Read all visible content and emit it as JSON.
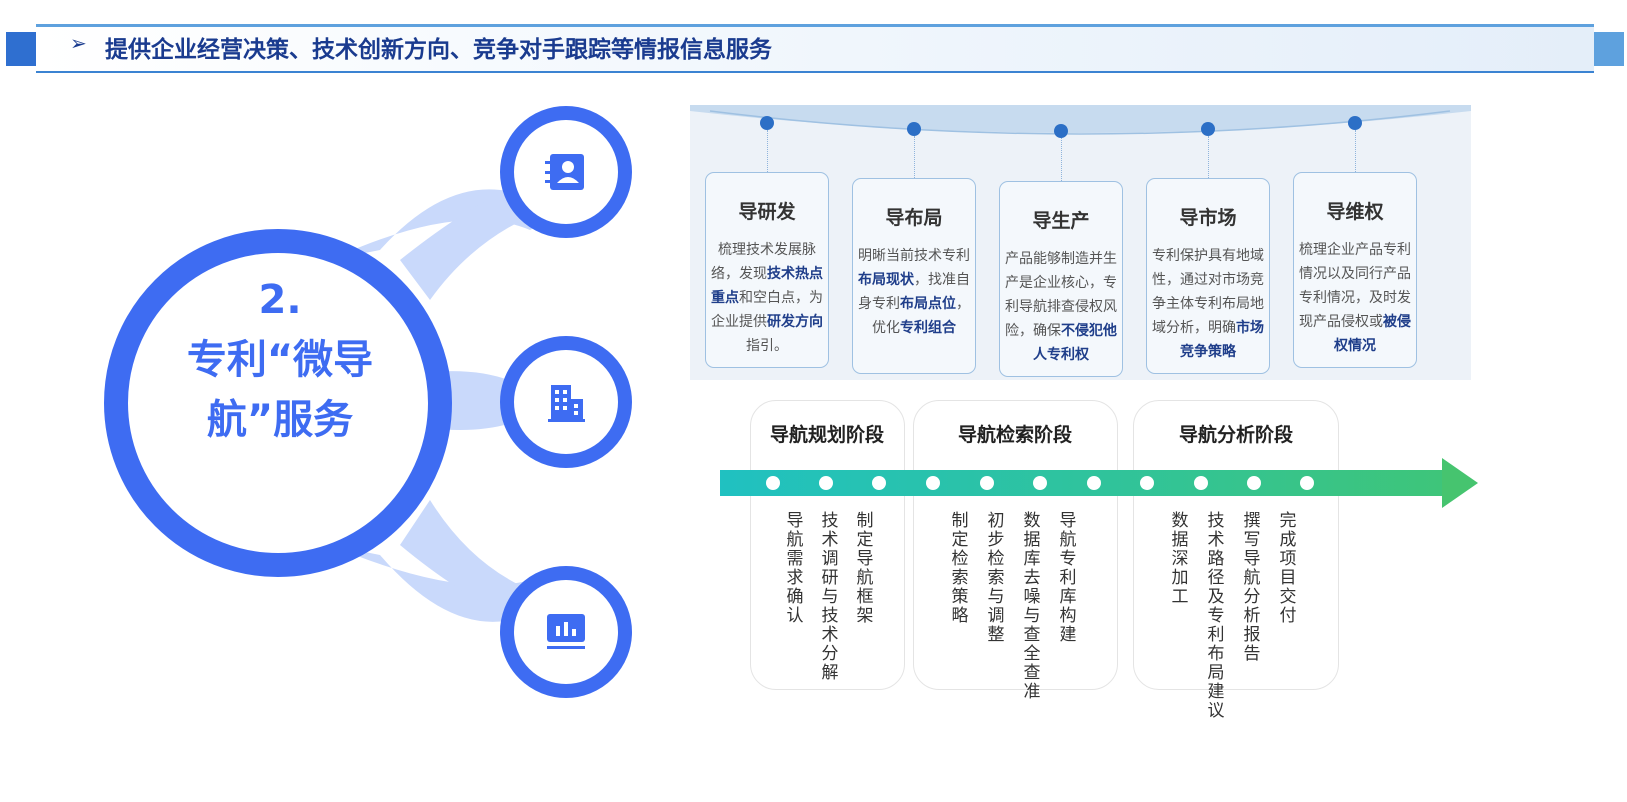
{
  "header": {
    "arrow": "➢",
    "title": "提供企业经营决策、技术创新方向、竞争对手跟踪等情报信息服务"
  },
  "center": {
    "line1": "2.",
    "line2": "专利“微导",
    "line3": "航”服务"
  },
  "icons": [
    "contact-book-icon",
    "building-icon",
    "chart-board-icon"
  ],
  "colors": {
    "accent": "#3e6cf2",
    "light_blue": "#c9d9fb",
    "header_text": "#1a3b8f",
    "track_start": "#20c1c1",
    "track_end": "#46c46f"
  },
  "cards": [
    {
      "title": "导研发",
      "body": [
        "梳理技术发展脉",
        "络，发现",
        {
          "b": "技术热"
        },
        {
          "b": "点重点"
        },
        "和空白点，",
        "为企业提供",
        {
          "b": "研发"
        },
        {
          "b": "方向"
        },
        "指引。"
      ]
    },
    {
      "title": "导布局",
      "body": [
        "明晰当前技术专",
        "利",
        {
          "b": "布局现状"
        },
        "，找",
        "准自身专利",
        {
          "b": "布局"
        },
        {
          "b": "点位"
        },
        "，优化",
        {
          "b": "专利"
        },
        {
          "b": "组合"
        }
      ]
    },
    {
      "title": "导生产",
      "body": [
        "产品能够制造并",
        "生产是企业核心，",
        "专利导航排查侵",
        "权风险，确保",
        {
          "b": "不"
        },
        {
          "b": "侵犯他人专利权"
        }
      ]
    },
    {
      "title": "导市场",
      "body": [
        "专利保护具有地域",
        "性，通过对市场竞",
        "争主体专利布局地",
        "域分析，明确",
        {
          "b": "市场"
        },
        {
          "b": "竞争策略"
        }
      ]
    },
    {
      "title": "导维权",
      "body": [
        "梳理企业产品专",
        "利情况以及同行",
        "产品专利情况，",
        "及时发现产品侵",
        "权或",
        {
          "b": "被侵权情况"
        }
      ]
    }
  ],
  "stages": [
    {
      "title": "导航规划阶段",
      "steps": [
        "导航需求确认",
        "技术调研与技术分解",
        "制定导航框架"
      ]
    },
    {
      "title": "导航检索阶段",
      "steps": [
        "制定检索策略",
        "初步检索与调整",
        "数据库去噪与查全查准",
        "导航专利库构建"
      ]
    },
    {
      "title": "导航分析阶段",
      "steps": [
        "数据深加工",
        "技术路径及专利布局建议",
        "撰写导航分析报告",
        "完成项目交付"
      ]
    }
  ]
}
